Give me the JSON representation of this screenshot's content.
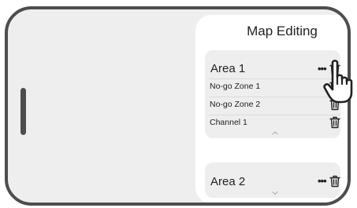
{
  "panel": {
    "title": "Map Editing",
    "areas": [
      {
        "name": "Area 1",
        "more_label": "•••",
        "expanded": true,
        "zones": [
          {
            "label": "No-go Zone 1"
          },
          {
            "label": "No-go Zone 2"
          },
          {
            "label": "Channel 1"
          }
        ]
      },
      {
        "name": "Area 2",
        "more_label": "•••",
        "expanded": false
      }
    ]
  },
  "icons": {
    "trash": "trash-icon",
    "more": "more-options-icon",
    "collapse": "chevron-up-icon",
    "expand": "chevron-down-icon",
    "cursor": "pointing-hand-icon"
  },
  "colors": {
    "frame": "#4d4d4d",
    "background": "#eeeeee",
    "panel": "#ffffff",
    "card": "#eeeeee"
  }
}
